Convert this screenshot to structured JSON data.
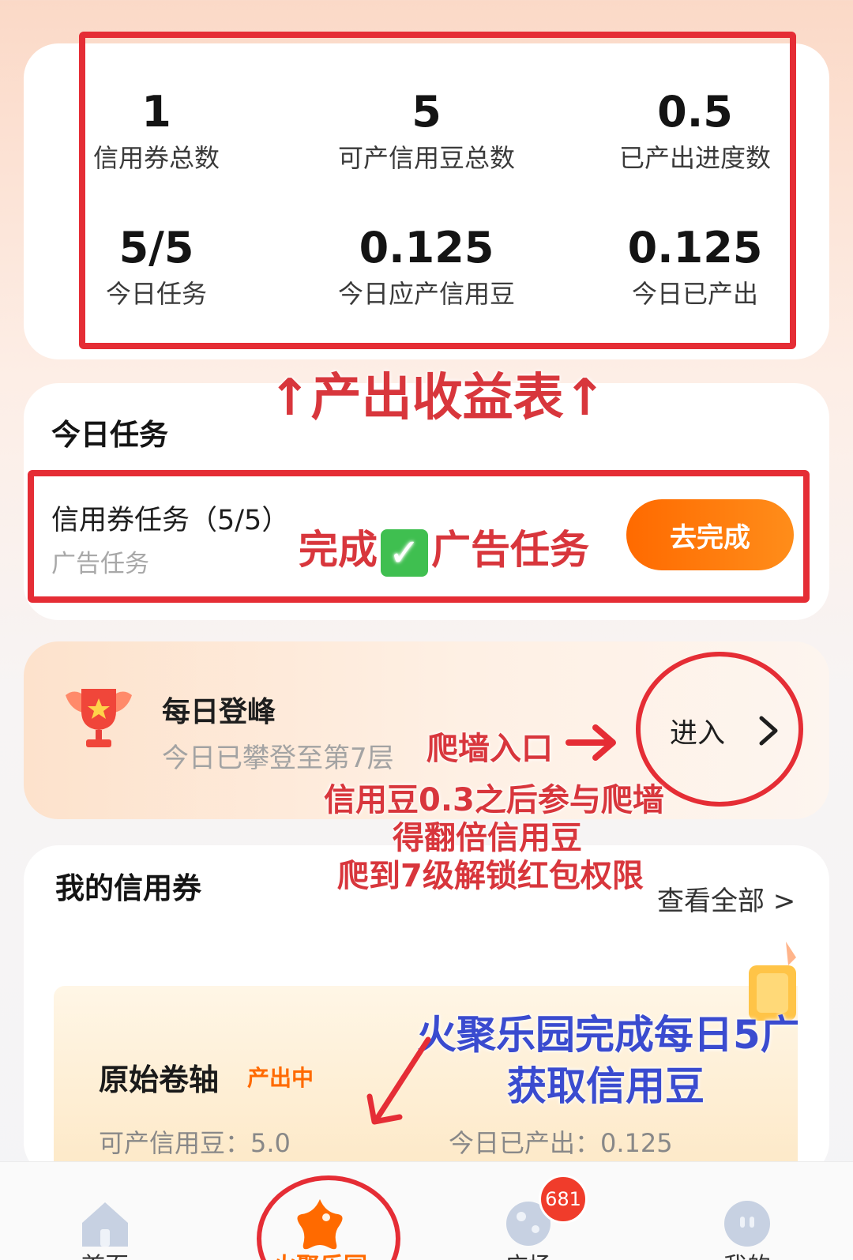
{
  "stats": [
    {
      "value": "1",
      "label": "信用券总数"
    },
    {
      "value": "5",
      "label": "可产信用豆总数"
    },
    {
      "value": "0.5",
      "label": "已产出进度数"
    },
    {
      "value": "5/5",
      "label": "今日任务"
    },
    {
      "value": "0.125",
      "label": "今日应产信用豆"
    },
    {
      "value": "0.125",
      "label": "今日已产出"
    }
  ],
  "today_tasks": {
    "title": "今日任务",
    "task_title": "信用券任务（5/5）",
    "task_subtitle": "广告任务",
    "button_label": "去完成"
  },
  "daily_climb": {
    "title": "每日登峰",
    "subtitle": "今日已攀登至第7层",
    "enter_label": "进入"
  },
  "my_vouchers": {
    "title": "我的信用券",
    "view_all": "查看全部 >",
    "item": {
      "name": "原始卷轴",
      "status": "产出中",
      "producible": "可产信用豆：5.0",
      "produced_today": "今日已产出：0.125"
    }
  },
  "bottom_nav": {
    "items": [
      "首页",
      "火聚乐园",
      "广场",
      "我的"
    ],
    "badge": "681",
    "active_color": "#ff6a00"
  },
  "annotations": {
    "stats_caption": "↑产出收益表↑",
    "task_note_before": "完成",
    "task_note_after": "广告任务",
    "climb_entry": "爬墙入口",
    "climb_line1": "信用豆0.3之后参与爬墙",
    "climb_line2": "得翻倍信用豆",
    "climb_line3": "爬到7级解锁红包权限",
    "park_line1": "火聚乐园完成每日5广",
    "park_line2": "获取信用豆"
  },
  "colors": {
    "accent": "#ff6a00",
    "annotation_red": "#e52d35",
    "annotation_blue": "#3a4bcf"
  }
}
